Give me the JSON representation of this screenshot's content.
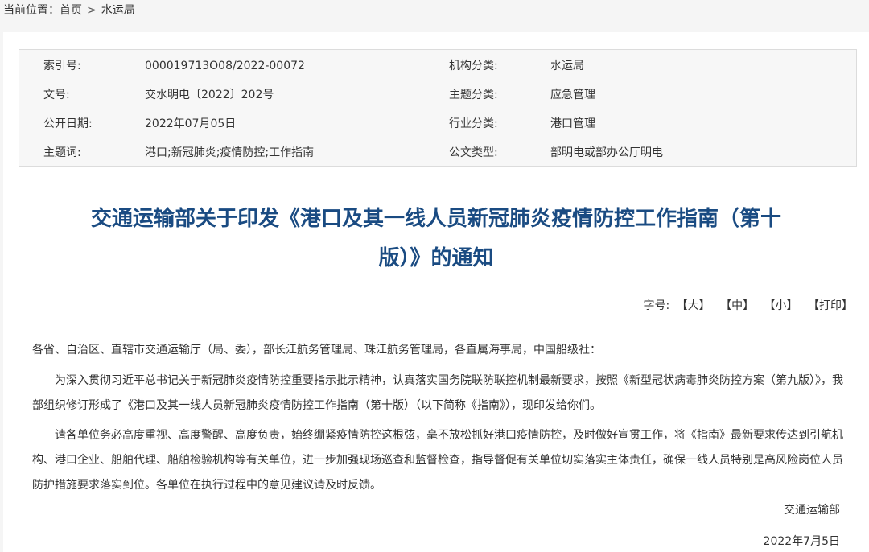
{
  "breadcrumb": {
    "label": "当前位置：",
    "home": "首页",
    "separator": ">",
    "current": "水运局"
  },
  "meta": {
    "rows": [
      {
        "k1": "索引号:",
        "v1": "000019713O08/2022-00072",
        "k2": "机构分类:",
        "v2": "水运局"
      },
      {
        "k1": "文号:",
        "v1": "交水明电〔2022〕202号",
        "k2": "主题分类:",
        "v2": "应急管理"
      },
      {
        "k1": "公开日期:",
        "v1": "2022年07月05日",
        "k2": "行业分类:",
        "v2": "港口管理"
      },
      {
        "k1": "主题词:",
        "v1": "港口;新冠肺炎;疫情防控;工作指南",
        "k2": "公文类型:",
        "v2": "部明电或部办公厅明电"
      }
    ]
  },
  "title": {
    "line1": "交通运输部关于印发《港口及其一线人员新冠肺炎疫情防控工作指南（第十",
    "line2": "版）》的通知"
  },
  "font_size": {
    "label": "字号:",
    "large": "【大】",
    "medium": "【中】",
    "small": "【小】",
    "print": "【打印】"
  },
  "body": {
    "salutation": "各省、自治区、直辖市交通运输厅（局、委），部长江航务管理局、珠江航务管理局，各直属海事局，中国船级社：",
    "para1": "为深入贯彻习近平总书记关于新冠肺炎疫情防控重要指示批示精神，认真落实国务院联防联控机制最新要求，按照《新型冠状病毒肺炎防控方案（第九版）》，我部组织修订形成了《港口及其一线人员新冠肺炎疫情防控工作指南（第十版）（以下简称《指南》），现印发给你们。",
    "para2": "请各单位务必高度重视、高度警醒、高度负责，始终绷紧疫情防控这根弦，毫不放松抓好港口疫情防控，及时做好宣贯工作，将《指南》最新要求传达到引航机构、港口企业、船舶代理、船舶检验机构等有关单位，进一步加强现场巡查和监督检查，指导督促有关单位切实落实主体责任，确保一线人员特别是高风险岗位人员防护措施要求落实到位。各单位在执行过程中的意见建议请及时反馈。",
    "signer": "交通运输部",
    "date": "2022年7月5日"
  }
}
